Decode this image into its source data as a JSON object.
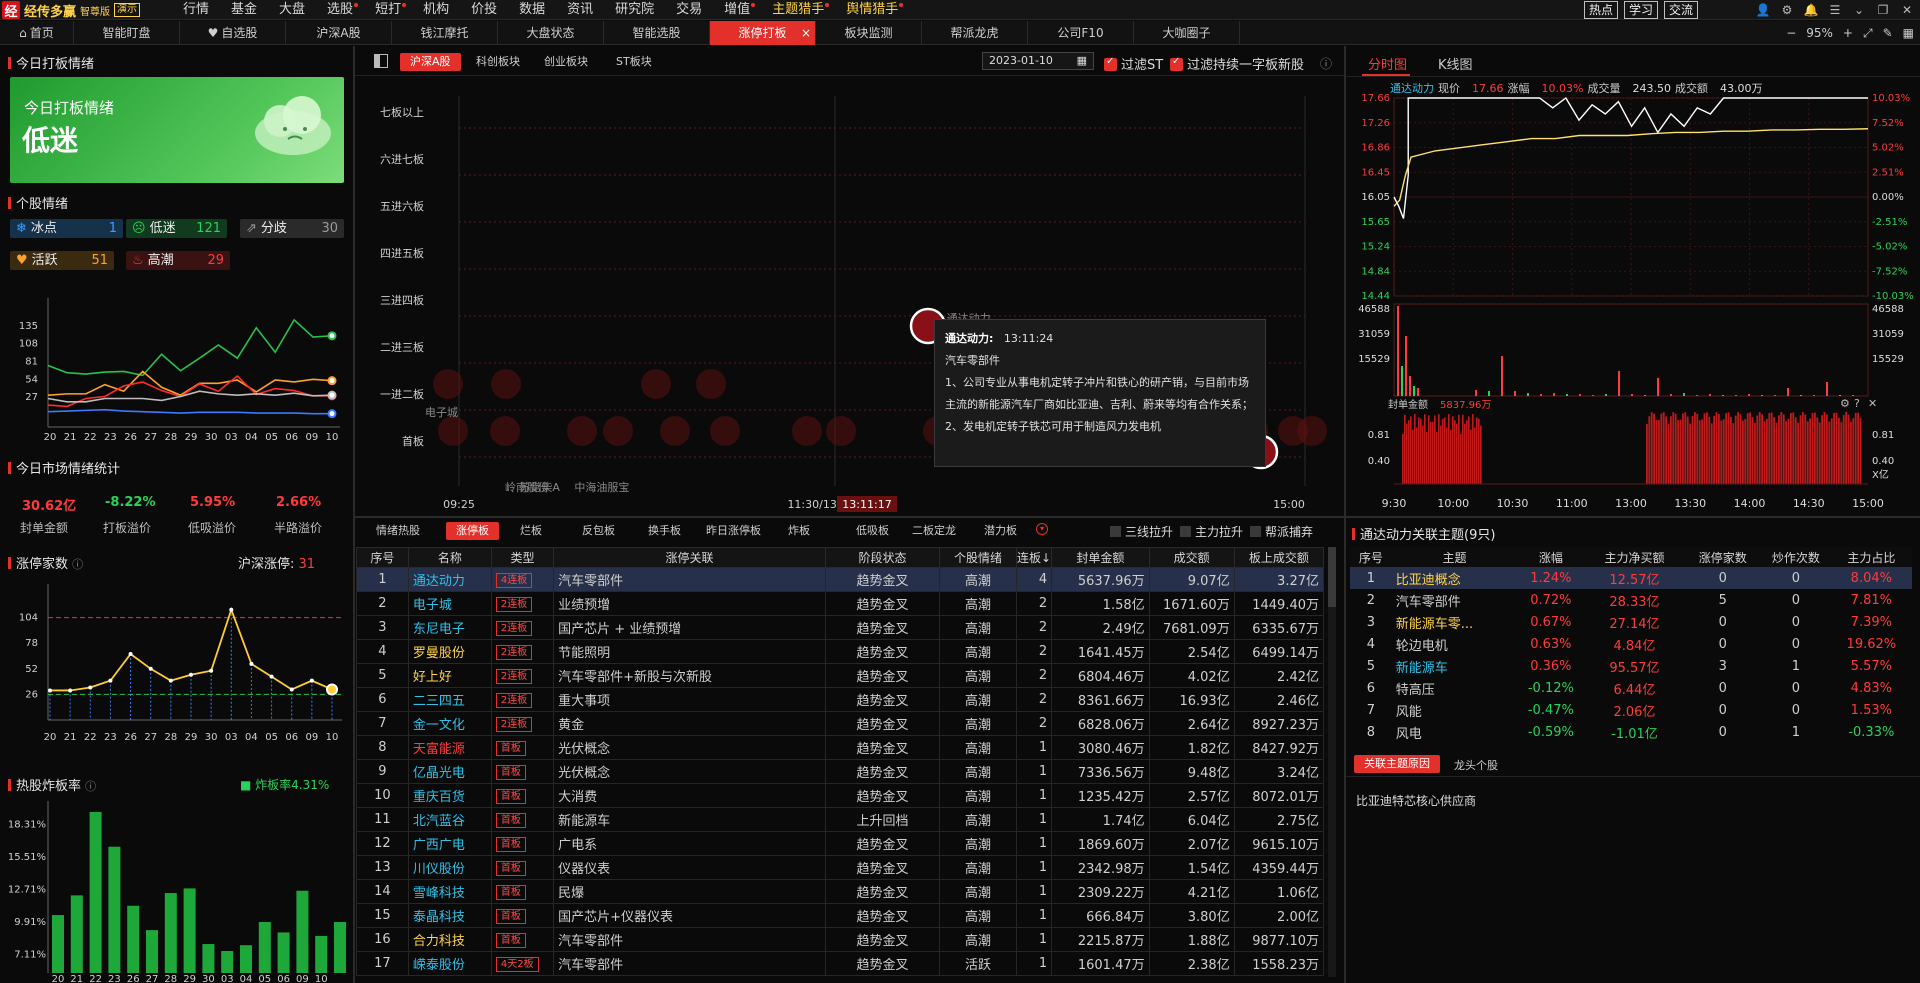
{
  "app": {
    "name": "经传多赢",
    "edition": "智尊版",
    "version_badge": "演示"
  },
  "menu": [
    {
      "label": "行情",
      "dot": false
    },
    {
      "label": "基金",
      "dot": false
    },
    {
      "label": "大盘",
      "dot": false
    },
    {
      "label": "选股",
      "dot": true
    },
    {
      "label": "短打",
      "dot": true
    },
    {
      "label": "机构",
      "dot": false
    },
    {
      "label": "价投",
      "dot": false
    },
    {
      "label": "数据",
      "dot": false
    },
    {
      "label": "资讯",
      "dot": false
    },
    {
      "label": "研究院",
      "dot": false
    },
    {
      "label": "交易",
      "dot": false
    },
    {
      "label": "增值",
      "dot": true
    },
    {
      "label": "主题猎手",
      "dot": true,
      "hl": true
    },
    {
      "label": "舆情猎手",
      "dot": true,
      "hl": true
    }
  ],
  "top_right": {
    "buttons": [
      "热点",
      "学习",
      "交流"
    ]
  },
  "tabs": [
    {
      "label": "首页",
      "icon": "home-icon"
    },
    {
      "label": "智能盯盘"
    },
    {
      "label": "自选股",
      "icon": "heart-icon"
    },
    {
      "label": "沪深A股"
    },
    {
      "label": "钱江摩托"
    },
    {
      "label": "大盘状态"
    },
    {
      "label": "智能选股"
    },
    {
      "label": "涨停打板",
      "active": true
    },
    {
      "label": "板块监测"
    },
    {
      "label": "帮派龙虎"
    },
    {
      "label": "公司F10"
    },
    {
      "label": "大咖圈子"
    }
  ],
  "tab_right": {
    "zoom": "95%"
  },
  "left": {
    "today_title": "今日打板情绪",
    "banner_line1": "今日打板情绪",
    "banner_line2": "低迷",
    "stock_mood_title": "个股情绪",
    "chips": [
      {
        "label": "冰点",
        "value": "1",
        "icon": "snowflake-icon",
        "bg": "#15324a",
        "color": "#3aa0ff"
      },
      {
        "label": "低迷",
        "value": "121",
        "icon": "sad-face-icon",
        "bg": "#113a1f",
        "color": "#27d35a"
      },
      {
        "label": "分歧",
        "value": "30",
        "icon": "share-icon",
        "bg": "#2a2a2a",
        "color": "#9a9a9a"
      },
      {
        "label": "活跃",
        "value": "51",
        "icon": "heart-icon",
        "bg": "#3a2a10",
        "color": "#ffa12a"
      },
      {
        "label": "高潮",
        "value": "29",
        "icon": "flame-icon",
        "bg": "#3a1212",
        "color": "#ff3b3b"
      }
    ],
    "mood_chart": {
      "y_ticks": [
        "135",
        "108",
        "81",
        "54",
        "27"
      ],
      "x_ticks": [
        "20",
        "21",
        "22",
        "23",
        "26",
        "27",
        "28",
        "29",
        "30",
        "03",
        "04",
        "05",
        "06",
        "09",
        "10"
      ],
      "series": [
        {
          "color": "#27c24a",
          "values": [
            75,
            64,
            62,
            65,
            66,
            60,
            92,
            67,
            86,
            106,
            86,
            132,
            95,
            144,
            118,
            120
          ]
        },
        {
          "color": "#ffa12a",
          "values": [
            30,
            32,
            32,
            46,
            36,
            66,
            42,
            30,
            48,
            48,
            53,
            35,
            53,
            50,
            54,
            52
          ]
        },
        {
          "color": "#ff2a2a",
          "values": [
            15,
            13,
            25,
            28,
            44,
            50,
            37,
            28,
            47,
            36,
            59,
            31,
            40,
            37,
            29,
            29
          ]
        },
        {
          "color": "#bdbdbd",
          "values": [
            25,
            20,
            20,
            25,
            25,
            25,
            22,
            28,
            36,
            32,
            30,
            32,
            30,
            33,
            29,
            30
          ]
        },
        {
          "color": "#3a7bff",
          "values": [
            5,
            6,
            7,
            8,
            6,
            5,
            4,
            3,
            4,
            4,
            4,
            3,
            3,
            3,
            2,
            2
          ]
        }
      ]
    },
    "market_title": "今日市场情绪统计",
    "stats": [
      {
        "value": "30.62亿",
        "label": "封单金额",
        "color": "#ff3b3b"
      },
      {
        "value": "-8.22%",
        "label": "打板溢价",
        "color": "#27d35a"
      },
      {
        "value": "5.95%",
        "label": "低吸溢价",
        "color": "#ff3b3b"
      },
      {
        "value": "2.66%",
        "label": "半路溢价",
        "color": "#ff3b3b"
      }
    ],
    "limitup_title": "涨停家数",
    "limitup_market_label": "沪深涨停:",
    "limitup_market_value": "31",
    "limitup_chart": {
      "y_ticks": [
        "104",
        "78",
        "52",
        "26"
      ],
      "x_ticks": [
        "20",
        "21",
        "22",
        "23",
        "26",
        "27",
        "28",
        "29",
        "30",
        "03",
        "04",
        "05",
        "06",
        "09",
        "10"
      ],
      "values": [
        30,
        30,
        33,
        40,
        67,
        52,
        40,
        46,
        50,
        112,
        57,
        44,
        31,
        40,
        31
      ]
    },
    "blowup_title": "热股炸板率",
    "blowup_label": "炸板率4.31%",
    "blowup_chart": {
      "y_ticks": [
        "18.31%",
        "15.51%",
        "12.71%",
        "9.91%",
        "7.11%"
      ],
      "x_ticks": [
        "20",
        "21",
        "22",
        "23",
        "26",
        "27",
        "28",
        "29",
        "30",
        "03",
        "04",
        "05",
        "06",
        "09",
        "10"
      ],
      "values": [
        10.5,
        12.2,
        19.4,
        16.4,
        11.3,
        9.2,
        12.4,
        12.8,
        8.0,
        7.4,
        7.9,
        9.9,
        9.0,
        12.6,
        8.7,
        9.9
      ]
    }
  },
  "middle": {
    "market_tabs": [
      "沪深A股",
      "科创板块",
      "创业板块",
      "ST板块"
    ],
    "date": "2023-01-10",
    "filter_st": "过滤ST",
    "filter_new": "过滤持续一字板新股",
    "levels": [
      "七板以上",
      "六进七板",
      "五进六板",
      "四进五板",
      "三进四板",
      "二进三板",
      "一进二板",
      "首板"
    ],
    "bubble_labels": [
      {
        "text": "电子城",
        "x": 0.03,
        "row": 6
      },
      {
        "text": "岭南股份",
        "x": 0.03,
        "row": 7
      },
      {
        "text": "苏常柴A",
        "x": 0.095,
        "row": 7
      },
      {
        "text": "中海油服宝",
        "x": 0.16,
        "row": 7
      },
      {
        "text": "通达动力",
        "x": 0.6,
        "row": 4
      }
    ],
    "time_left": "09:25",
    "time_mid": "11:30/13:00",
    "time_cursor": "13:11:17",
    "time_right": "15:00",
    "tooltip": {
      "stock": "通达动力:",
      "time": "13:11:24",
      "theme": "汽车零部件",
      "line1": "1、公司专业从事电机定转子冲片和铁心的研产销，与目前市场主流的新能源汽车厂商如比亚迪、吉利、蔚来等均有合作关系；",
      "line2": "2、发电机定转子铁芯可用于制造风力发电机"
    },
    "list_tabs": [
      "情绪热股",
      "涨停板",
      "烂板",
      "反包板",
      "换手板",
      "昨日涨停板",
      "炸板",
      "低吸板",
      "二板定龙",
      "潜力板"
    ],
    "list_checks": [
      "三线拉升",
      "主力拉升",
      "帮派捕弃"
    ],
    "columns": [
      "序号",
      "名称",
      "类型",
      "涨停关联",
      "阶段状态",
      "个股情绪",
      "连板↓",
      "封单金额",
      "成交额",
      "板上成交额"
    ],
    "rows": [
      [
        "1",
        "通达动力",
        "4连板",
        "汽车零部件",
        "趋势金叉",
        "高潮",
        "4",
        "5637.96万",
        "9.07亿",
        "3.27亿"
      ],
      [
        "2",
        "电子城",
        "2连板",
        "业绩预增",
        "趋势金叉",
        "高潮",
        "2",
        "1.58亿",
        "1671.60万",
        "1449.40万"
      ],
      [
        "3",
        "东尼电子",
        "2连板",
        "国产芯片 + 业绩预增",
        "趋势金叉",
        "高潮",
        "2",
        "2.49亿",
        "7681.09万",
        "6335.67万"
      ],
      [
        "4",
        "罗曼股份",
        "2连板",
        "节能照明",
        "趋势金叉",
        "高潮",
        "2",
        "1641.45万",
        "2.54亿",
        "6499.14万"
      ],
      [
        "5",
        "好上好",
        "2连板",
        "汽车零部件+新股与次新股",
        "趋势金叉",
        "高潮",
        "2",
        "6804.46万",
        "4.02亿",
        "2.42亿"
      ],
      [
        "6",
        "二三四五",
        "2连板",
        "重大事项",
        "趋势金叉",
        "高潮",
        "2",
        "8361.66万",
        "16.93亿",
        "2.46亿"
      ],
      [
        "7",
        "金一文化",
        "2连板",
        "黄金",
        "趋势金叉",
        "高潮",
        "2",
        "6828.06万",
        "2.64亿",
        "8927.23万"
      ],
      [
        "8",
        "天富能源",
        "首板",
        "光伏概念",
        "趋势金叉",
        "高潮",
        "1",
        "3080.46万",
        "1.82亿",
        "8427.92万"
      ],
      [
        "9",
        "亿晶光电",
        "首板",
        "光伏概念",
        "趋势金叉",
        "高潮",
        "1",
        "7336.56万",
        "9.48亿",
        "3.24亿"
      ],
      [
        "10",
        "重庆百货",
        "首板",
        "大消费",
        "趋势金叉",
        "高潮",
        "1",
        "1235.42万",
        "2.57亿",
        "8072.01万"
      ],
      [
        "11",
        "北汽蓝谷",
        "首板",
        "新能源车",
        "上升回档",
        "高潮",
        "1",
        "1.74亿",
        "6.04亿",
        "2.75亿"
      ],
      [
        "12",
        "广西广电",
        "首板",
        "广电系",
        "趋势金叉",
        "高潮",
        "1",
        "1869.60万",
        "2.07亿",
        "9615.10万"
      ],
      [
        "13",
        "川仪股份",
        "首板",
        "仪器仪表",
        "趋势金叉",
        "高潮",
        "1",
        "2342.98万",
        "1.54亿",
        "4359.44万"
      ],
      [
        "14",
        "雪峰科技",
        "首板",
        "民爆",
        "趋势金叉",
        "高潮",
        "1",
        "2309.22万",
        "4.21亿",
        "1.06亿"
      ],
      [
        "15",
        "泰晶科技",
        "首板",
        "国产芯片+仪器仪表",
        "趋势金叉",
        "高潮",
        "1",
        "666.84万",
        "3.80亿",
        "2.00亿"
      ],
      [
        "16",
        "合力科技",
        "首板",
        "汽车零部件",
        "趋势金叉",
        "高潮",
        "1",
        "2215.87万",
        "1.88亿",
        "9877.10万"
      ],
      [
        "17",
        "嵘泰股份",
        "4天2板",
        "汽车零部件",
        "趋势金叉",
        "活跃",
        "1",
        "1601.47万",
        "2.38亿",
        "1558.23万"
      ]
    ],
    "name_colors": [
      "cyan",
      "cyan",
      "cyan",
      "yellow",
      "yellow",
      "cyan",
      "cyan",
      "red",
      "cyan",
      "cyan",
      "cyan",
      "cyan",
      "cyan",
      "cyan",
      "cyan",
      "yellow",
      "cyan"
    ]
  },
  "right": {
    "chart_tabs": [
      "分时图",
      "K线图"
    ],
    "info": {
      "name": "通达动力",
      "price_label": "现价",
      "price": "17.66",
      "chg_label": "涨幅",
      "chg": "10.03%",
      "vol_label": "成交量",
      "vol": "243.50",
      "amt_label": "成交额",
      "amt": "43.00万"
    },
    "price_ticks": [
      "17.66",
      "17.26",
      "16.86",
      "16.45",
      "16.05",
      "15.65",
      "15.24",
      "14.84",
      "14.44"
    ],
    "pct_ticks": [
      "10.03%",
      "7.52%",
      "5.02%",
      "2.51%",
      "0.00%",
      "-2.51%",
      "-5.02%",
      "-7.52%",
      "-10.03%"
    ],
    "vol_ticks": [
      "46588",
      "31059",
      "15529"
    ],
    "seal_label": "封单金额",
    "seal_value": "5837.96万",
    "seal_ticks": [
      "0.81",
      "0.40"
    ],
    "seal_unit": "X亿",
    "time_ticks": [
      "9:30",
      "10:00",
      "10:30",
      "11:00",
      "13:00",
      "13:30",
      "14:00",
      "14:30",
      "15:00"
    ],
    "theme_title": "通达动力关联主题(9只)",
    "theme_columns": [
      "序号",
      "主题",
      "涨幅",
      "主力净买额",
      "涨停家数",
      "炒作次数",
      "主力占比"
    ],
    "theme_rows": [
      [
        "1",
        "比亚迪概念",
        "1.24%",
        "12.57亿",
        "0",
        "0",
        "8.04%"
      ],
      [
        "2",
        "汽车零部件",
        "0.72%",
        "28.33亿",
        "5",
        "0",
        "7.81%"
      ],
      [
        "3",
        "新能源车零...",
        "0.67%",
        "27.14亿",
        "0",
        "0",
        "7.39%"
      ],
      [
        "4",
        "轮边电机",
        "0.63%",
        "4.84亿",
        "0",
        "0",
        "19.62%"
      ],
      [
        "5",
        "新能源车",
        "0.36%",
        "95.57亿",
        "3",
        "1",
        "5.57%"
      ],
      [
        "6",
        "特高压",
        "-0.12%",
        "6.44亿",
        "0",
        "0",
        "4.83%"
      ],
      [
        "7",
        "风能",
        "-0.47%",
        "2.06亿",
        "0",
        "0",
        "1.53%"
      ],
      [
        "8",
        "风电",
        "-0.59%",
        "-1.01亿",
        "0",
        "1",
        "-0.33%"
      ]
    ],
    "sub_tabs": [
      "关联主题原因",
      "龙头个股"
    ],
    "reason": "比亚迪特芯核心供应商"
  },
  "colors": {
    "accent": "#e3302a",
    "up": "#ff3b3b",
    "down": "#27d35a",
    "info": "#30c0e8",
    "gold": "#ffd24a"
  }
}
